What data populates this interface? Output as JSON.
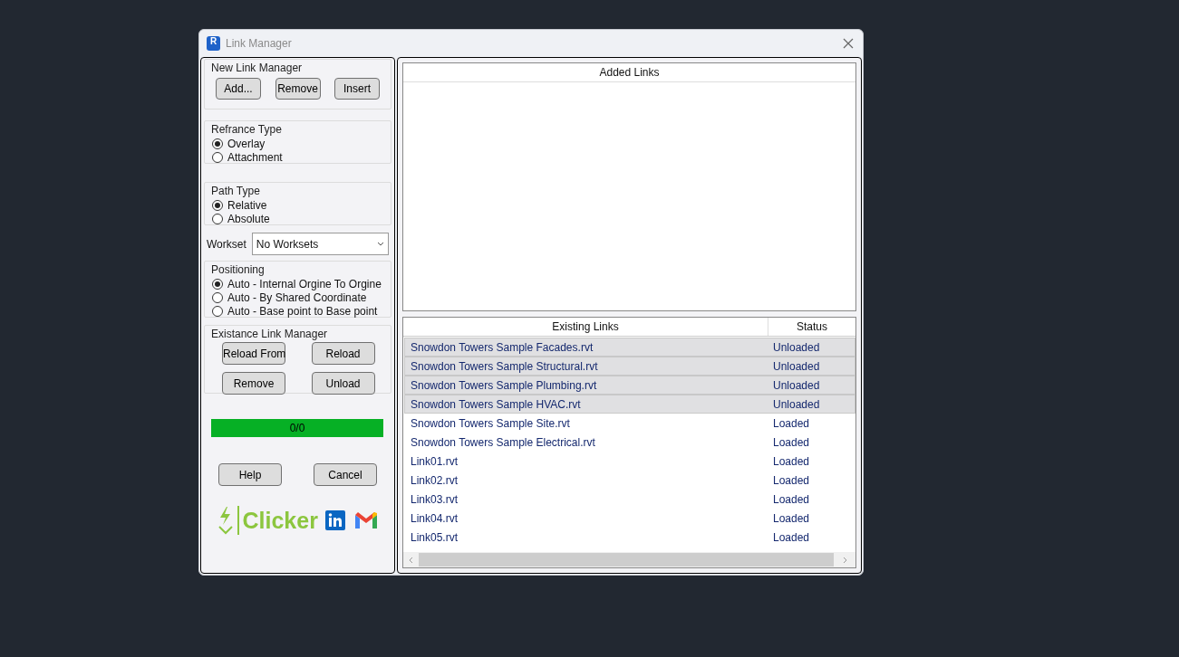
{
  "window": {
    "title": "Link Manager",
    "icon_label": "R"
  },
  "new_link_manager": {
    "title": "New Link Manager",
    "buttons": [
      "Add...",
      "Remove",
      "Insert"
    ]
  },
  "reference_type": {
    "title": "Refrance Type",
    "options": [
      {
        "label": "Overlay",
        "selected": true
      },
      {
        "label": "Attachment",
        "selected": false
      }
    ]
  },
  "path_type": {
    "title": "Path Type",
    "options": [
      {
        "label": "Relative",
        "selected": true
      },
      {
        "label": "Absolute",
        "selected": false
      }
    ]
  },
  "workset": {
    "label": "Workset",
    "value": "No Worksets"
  },
  "positioning": {
    "title": "Positioning",
    "options": [
      {
        "label": "Auto - Internal Orgine To Orgine",
        "selected": true
      },
      {
        "label": "Auto - By Shared Coordinate",
        "selected": false
      },
      {
        "label": "Auto - Base point to Base point",
        "selected": false
      }
    ]
  },
  "existance_link_manager": {
    "title": "Existance Link Manager",
    "buttons": [
      "Reload From",
      "Reload",
      "Remove",
      "Unload"
    ]
  },
  "progress": {
    "level": 1,
    "text": "0/0"
  },
  "footer_buttons": [
    "Help",
    "Cancel"
  ],
  "brand": {
    "name": "Clicker"
  },
  "added_links": {
    "header": "Added Links"
  },
  "existing_links": {
    "columns": [
      "Existing Links",
      "Status"
    ],
    "rows": [
      {
        "name": "Snowdon Towers Sample Facades.rvt",
        "status": "Unloaded",
        "selected": true
      },
      {
        "name": "Snowdon Towers Sample Structural.rvt",
        "status": "Unloaded",
        "selected": true
      },
      {
        "name": "Snowdon Towers Sample Plumbing.rvt",
        "status": "Unloaded",
        "selected": true
      },
      {
        "name": "Snowdon Towers Sample HVAC.rvt",
        "status": "Unloaded",
        "selected": true
      },
      {
        "name": "Snowdon Towers Sample Site.rvt",
        "status": "Loaded",
        "selected": false
      },
      {
        "name": "Snowdon Towers Sample Electrical.rvt",
        "status": "Loaded",
        "selected": false
      },
      {
        "name": "Link01.rvt",
        "status": "Loaded",
        "selected": false
      },
      {
        "name": "Link02.rvt",
        "status": "Loaded",
        "selected": false
      },
      {
        "name": "Link03.rvt",
        "status": "Loaded",
        "selected": false
      },
      {
        "name": "Link04.rvt",
        "status": "Loaded",
        "selected": false
      },
      {
        "name": "Link05.rvt",
        "status": "Loaded",
        "selected": false
      }
    ]
  }
}
